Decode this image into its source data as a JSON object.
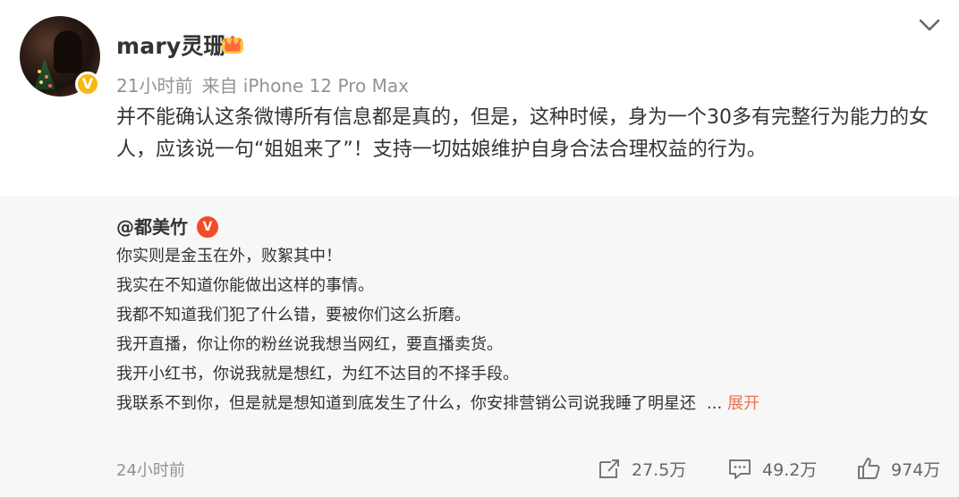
{
  "post": {
    "author": "mary灵珊",
    "time": "21小时前",
    "source": "来自 iPhone 12 Pro Max",
    "text": "并不能确认这条微博所有信息都是真的，但是，这种时候，身为一个30多有完整行为能力的女人，应该说一句“姐姐来了”！支持一切姑娘维护自身合法合理权益的行为。"
  },
  "icons": {
    "verified": "V",
    "repost_verified": "V",
    "crown": "crown-icon",
    "chevron": "chevron-down-icon",
    "repost": "repost-icon",
    "comment": "comment-icon",
    "like": "thumbs-up-icon"
  },
  "repost": {
    "author": "@都美竹",
    "lines": [
      "你实则是金玉在外，败絮其中！",
      "我实在不知道你能做出这样的事情。",
      "我都不知道我们犯了什么错，要被你们这么折磨。",
      "我开直播，你让你的粉丝说我想当网红，要直播卖货。",
      "我开小红书，你说我就是想红，为红不达目的不择手段。",
      "我联系不到你，但是就是想知道到底发生了什么，你安排营销公司说我睡了明星还"
    ],
    "ellipsis": "...",
    "expand": "展开",
    "time": "24小时前",
    "stats": {
      "reposts": "27.5万",
      "comments": "49.2万",
      "likes": "974万"
    }
  },
  "colors": {
    "accent": "#eb7350",
    "gold_badge": "#f6b913",
    "red_badge": "#f54b26",
    "muted": "#939393",
    "repost_bg": "#f7f7f7"
  }
}
